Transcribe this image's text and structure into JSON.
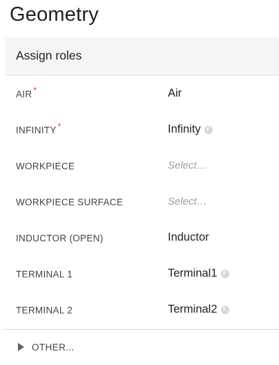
{
  "title": "Geometry",
  "panel": {
    "header": "Assign roles",
    "rows": [
      {
        "label": "AIR",
        "required": true,
        "value": "Air",
        "placeholder": false,
        "badge": ""
      },
      {
        "label": "INFINITY",
        "required": true,
        "value": "Infinity",
        "placeholder": false,
        "badge": "F"
      },
      {
        "label": "WORKPIECE",
        "required": false,
        "value": "Select…",
        "placeholder": true,
        "badge": ""
      },
      {
        "label": "WORKPIECE SURFACE",
        "required": false,
        "value": "Select…",
        "placeholder": true,
        "badge": ""
      },
      {
        "label": "INDUCTOR (OPEN)",
        "required": false,
        "value": "Inductor",
        "placeholder": false,
        "badge": ""
      },
      {
        "label": "TERMINAL 1",
        "required": false,
        "value": "Terminal1",
        "placeholder": false,
        "badge": "F"
      },
      {
        "label": "TERMINAL 2",
        "required": false,
        "value": "Terminal2",
        "placeholder": false,
        "badge": "F"
      }
    ],
    "required_mark": "*",
    "other": {
      "label": "OTHER...",
      "icon": "triangle-right-icon"
    }
  },
  "colors": {
    "header_bg": "#f5f5f5",
    "required": "#e53935",
    "placeholder": "#9e9e9e",
    "badge": "#d6d6d6"
  }
}
